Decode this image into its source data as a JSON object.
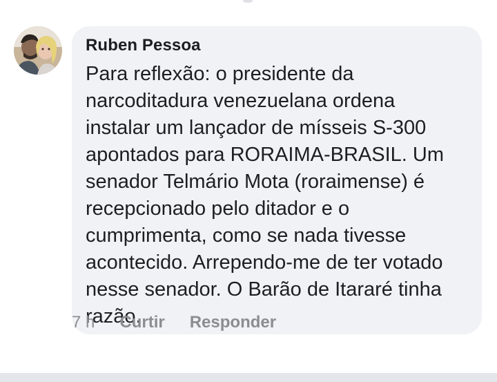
{
  "comment": {
    "author": "Ruben Pessoa",
    "text_lines": [
      "Para reflexão: o presidente da",
      "narcoditadura venezuelana ordena",
      "instalar um lançador de mísseis S-300",
      "apontados para RORAIMA-BRASIL. Um",
      "senador Telmário Mota (roraimense) é",
      "recepcionado pelo ditador e o",
      "cumprimenta, como se nada tivesse",
      "acontecido. Arrependo-me de ter votado",
      "nesse senador. O Barão de Itararé tinha",
      "razão."
    ],
    "timestamp": "7 h",
    "like_label": "Curtir",
    "reply_label": "Responder",
    "avatar_icon": "profile-photo"
  },
  "colors": {
    "bubble": "#f0f2f5",
    "text": "#1c1e21",
    "meta": "#8a8d91"
  }
}
